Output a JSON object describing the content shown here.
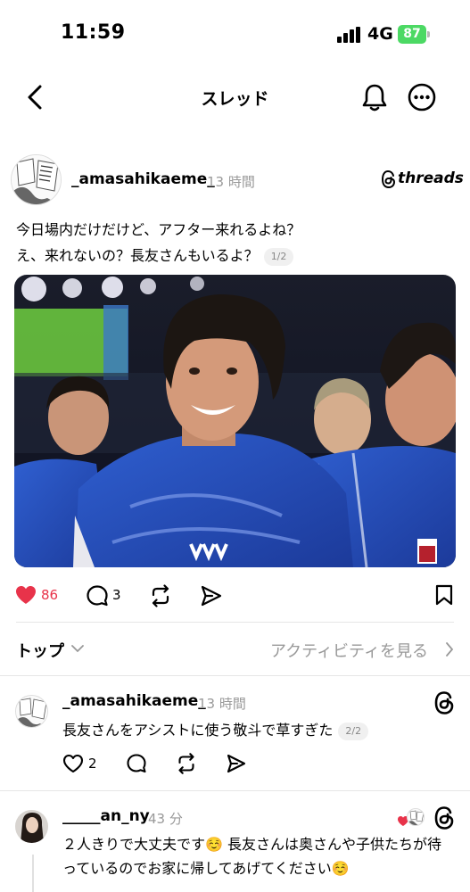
{
  "status": {
    "time": "11:59",
    "network": "4G",
    "battery": "87"
  },
  "nav": {
    "title": "スレッド",
    "back_icon": "chevron-left-icon",
    "bell_icon": "bell-icon",
    "more_icon": "more-icon"
  },
  "post": {
    "username": "_amasahikaeme_",
    "timestamp": "13 時間",
    "brand": "threads",
    "line1": "今日場内だけだけど、アフター来れるよね？",
    "line2": "え、来れないの？長友さんもいるよ？",
    "page_indicator": "1/2",
    "likes": "86",
    "comments": "3",
    "liked_color": "#e8334a"
  },
  "replies_bar": {
    "sort_label": "トップ",
    "activity_label": "アクティビティを見る"
  },
  "reply1": {
    "username": "_amasahikaeme_",
    "timestamp": "13 時間",
    "text": "長友さんをアシストに使う敬斗で草すぎた",
    "page_indicator": "2/2",
    "likes": "2"
  },
  "reply2": {
    "username": "_____an_ny",
    "timestamp": "43 分",
    "line1": "２人きりで大丈夫です☺️ 長友さんは奥さんや子供たちが待",
    "line2": "っているのでお家に帰してあげてください☺️"
  }
}
